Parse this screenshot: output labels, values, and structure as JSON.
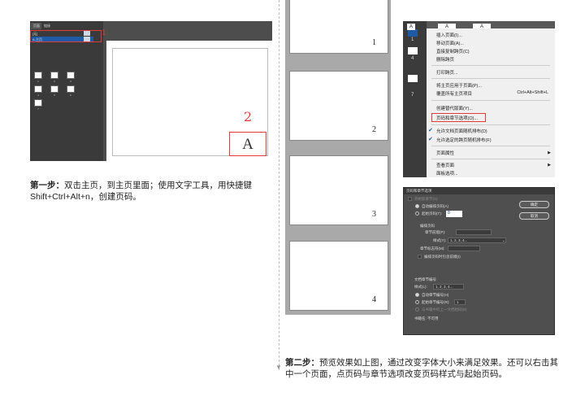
{
  "workspace": {
    "panel_tabs": [
      "页面",
      "链接"
    ],
    "panel_rows": [
      "[无]",
      "A-主页"
    ],
    "thumbs": [
      {
        "num": "1"
      },
      {
        "num": "2"
      },
      {
        "num": "3"
      },
      {
        "num": "4"
      },
      {
        "num": "5"
      },
      {
        "num": "6"
      },
      {
        "num": "7"
      }
    ],
    "annotation1": "1",
    "annotation2": "2",
    "page_marker": "A"
  },
  "step1": {
    "heading": "第一步：",
    "text": "双击主页，到主页里面；使用文字工具，用快捷键Shift+Ctrl+Alt+n，创建页码。"
  },
  "preview": {
    "pages": [
      "1",
      "2",
      "3",
      "4"
    ]
  },
  "menu": {
    "top_masters": [
      "A",
      "A",
      "A"
    ],
    "left_nums": [
      "1",
      "",
      "4",
      "",
      "7"
    ],
    "items": [
      {
        "label": "插入页面(I)..."
      },
      {
        "label": "移动页面(A)..."
      },
      {
        "label": "直接复制跨页(C)"
      },
      {
        "label": "删除跨页"
      },
      {
        "label": "打印跨页..."
      },
      {
        "label": "将主页应用于页面(P)..."
      },
      {
        "label": "覆盖所有主页项目",
        "shortcut": "Ctrl+Alt+Shift+L"
      },
      {
        "label": "创建替代版面(Y)..."
      },
      {
        "label": "页码和章节选项(O)..."
      },
      {
        "label": "允许文档页面随机排布(D)",
        "checked": true
      },
      {
        "label": "允许选定的跨页随机排布(F)",
        "checked": true
      },
      {
        "label": "页面属性",
        "submenu": true
      },
      {
        "label": "查看页面",
        "submenu": true
      },
      {
        "label": "面板选项..."
      }
    ]
  },
  "dialog": {
    "title": "页码和章节选项",
    "start_section": "开始新章节(S)",
    "auto_page": "自动编排页码(A)",
    "start_page": "起始页码(T):",
    "start_page_value": "8",
    "numbering_group": "编排页码",
    "section_prefix": "章节前缀(P):",
    "style_label": "样式(Y):",
    "style_value": "1, 2, 3, 4...",
    "section_marker": "章节标志符(M):",
    "include_prefix": "编排页码时包含前缀(I)",
    "doc_chapter_group": "文档章节编号",
    "chapter_style_label": "样式(L):",
    "chapter_style_value": "1, 2, 3, 4...",
    "auto_chapter": "自动章节编号(H)",
    "start_chapter": "起始章节编号(R):",
    "start_chapter_value": "1",
    "same_as_prev": "与书籍中的上一文档相同(B)",
    "book_name": "书籍名: 不可用",
    "ok_label": "确定",
    "cancel_label": "取消"
  },
  "step2": {
    "heading": "第二步：",
    "text": "预览效果如上图，通过改变字体大小来满足效果。还可以右击其中一个页面，点页码与章节选项改变页码样式与起始页码。"
  }
}
